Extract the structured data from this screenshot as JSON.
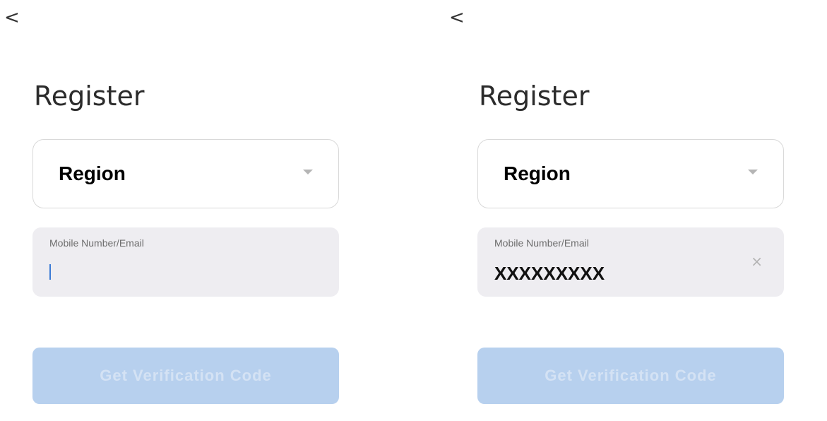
{
  "screens": [
    {
      "back_glyph": "<",
      "title": "Register",
      "region": {
        "label": "Region"
      },
      "input": {
        "label": "Mobile Number/Email",
        "value": ""
      },
      "button": {
        "label": "Get Verification Code",
        "state": "disabled"
      }
    },
    {
      "back_glyph": "<",
      "title": "Register",
      "region": {
        "label": "Region"
      },
      "input": {
        "label": "Mobile Number/Email",
        "value": "XXXXXXXXX"
      },
      "clear_glyph": "×",
      "button": {
        "label": "Get Verification Code",
        "state": "disabled"
      }
    }
  ],
  "colors": {
    "button_disabled_bg": "#b7d0ee",
    "input_bg": "#eeedf1",
    "cursor": "#3a7bd5"
  },
  "icons": [
    "back-chevron-icon",
    "dropdown-caret-icon",
    "clear-icon"
  ]
}
